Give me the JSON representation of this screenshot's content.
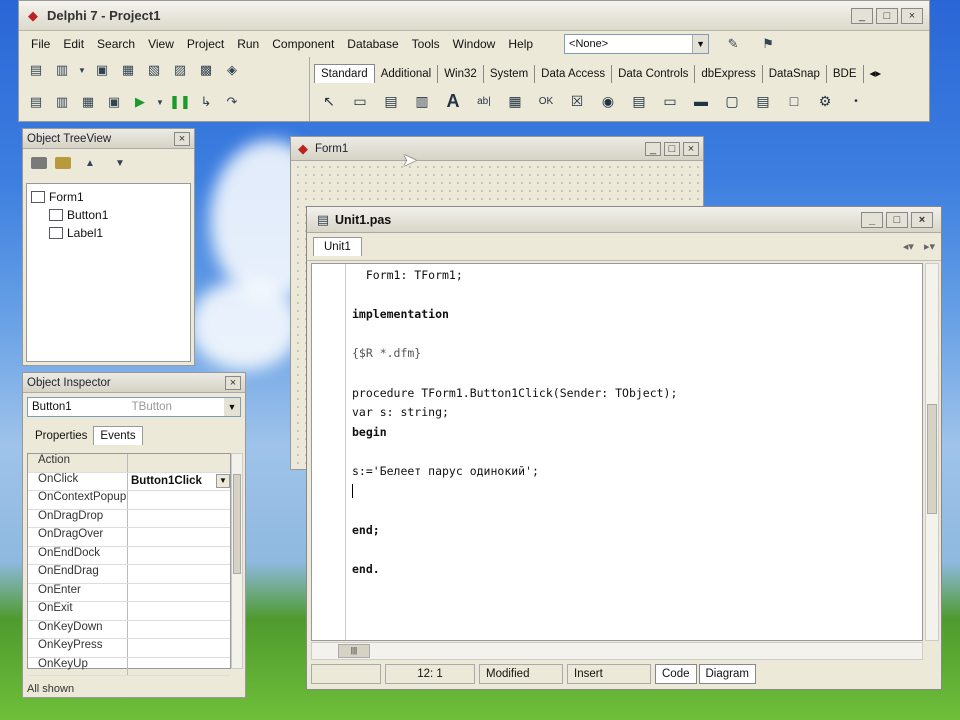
{
  "ide": {
    "title": "Delphi 7 - Project1",
    "menu": [
      "File",
      "Edit",
      "Search",
      "View",
      "Project",
      "Run",
      "Component",
      "Database",
      "Tools",
      "Window",
      "Help"
    ],
    "desktop_combo": "<None>",
    "palette_tabs": [
      "Standard",
      "Additional",
      "Win32",
      "System",
      "Data Access",
      "Data Controls",
      "dbExpress",
      "DataSnap",
      "BDE"
    ],
    "icons": {
      "new": "new-icon",
      "open": "open-icon",
      "save": "save-icon",
      "run": "run-icon",
      "pause": "pause-icon"
    }
  },
  "treeview": {
    "title": "Object TreeView",
    "nodes": [
      "Form1",
      "Button1",
      "Label1"
    ]
  },
  "inspector": {
    "title": "Object Inspector",
    "selected": "Button1",
    "selected_type": "TButton",
    "tabs": [
      "Properties",
      "Events"
    ],
    "active_tab": "Events",
    "rows": [
      {
        "name": "Action",
        "value": ""
      },
      {
        "name": "OnClick",
        "value": "Button1Click"
      },
      {
        "name": "OnContextPopup",
        "value": ""
      },
      {
        "name": "OnDragDrop",
        "value": ""
      },
      {
        "name": "OnDragOver",
        "value": ""
      },
      {
        "name": "OnEndDock",
        "value": ""
      },
      {
        "name": "OnEndDrag",
        "value": ""
      },
      {
        "name": "OnEnter",
        "value": ""
      },
      {
        "name": "OnExit",
        "value": ""
      },
      {
        "name": "OnKeyDown",
        "value": ""
      },
      {
        "name": "OnKeyPress",
        "value": ""
      },
      {
        "name": "OnKeyUp",
        "value": ""
      }
    ],
    "status": "All shown"
  },
  "form": {
    "title": "Form1"
  },
  "editor": {
    "title": "Unit1.pas",
    "tab": "Unit1",
    "lines": [
      "  Form1: TForm1;",
      "",
      "implementation",
      "",
      "{$R *.dfm}",
      "",
      "procedure TForm1.Button1Click(Sender: TObject);",
      "var s: string;",
      "begin",
      "",
      "s:='Белеет парус одинокий';",
      "",
      "",
      "end;",
      "",
      "end."
    ],
    "status": {
      "position": "12: 1",
      "modified": "Modified",
      "mode": "Insert",
      "tabs": [
        "Code",
        "Diagram"
      ]
    }
  }
}
